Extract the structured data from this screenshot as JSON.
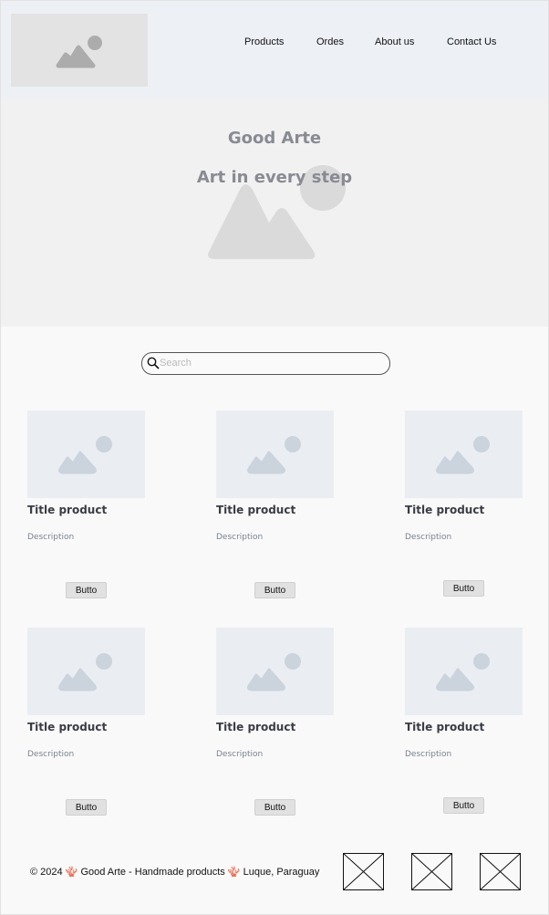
{
  "header": {
    "logo_icon": "image-placeholder-icon",
    "nav": [
      "Products",
      "Ordes",
      "About us",
      "Contact Us"
    ]
  },
  "hero": {
    "title": "Good Arte",
    "subtitle": "Art in every step",
    "image_icon": "image-placeholder-icon"
  },
  "search": {
    "placeholder": "Search",
    "icon": "search-icon"
  },
  "products": [
    {
      "title": "Title product",
      "description": "Description",
      "button": "Butto"
    },
    {
      "title": "Title product",
      "description": "Description",
      "button": "Butto"
    },
    {
      "title": "Title product",
      "description": "Description",
      "button": "Butto"
    },
    {
      "title": "Title product",
      "description": "Description",
      "button": "Butto"
    },
    {
      "title": "Title product",
      "description": "Description",
      "button": "Butto"
    },
    {
      "title": "Title product",
      "description": "Description",
      "button": "Butto"
    }
  ],
  "footer": {
    "text": "© 2024 🪸 Good Arte - Handmade products 🪸 Luque, Paraguay",
    "icons": [
      "social-placeholder-icon",
      "social-placeholder-icon",
      "social-placeholder-icon"
    ]
  },
  "colors": {
    "header_bg": "#edf0f5",
    "hero_bg": "#f1f1f1",
    "page_bg": "#f9f9f9",
    "placeholder": "#cbd3dd"
  }
}
